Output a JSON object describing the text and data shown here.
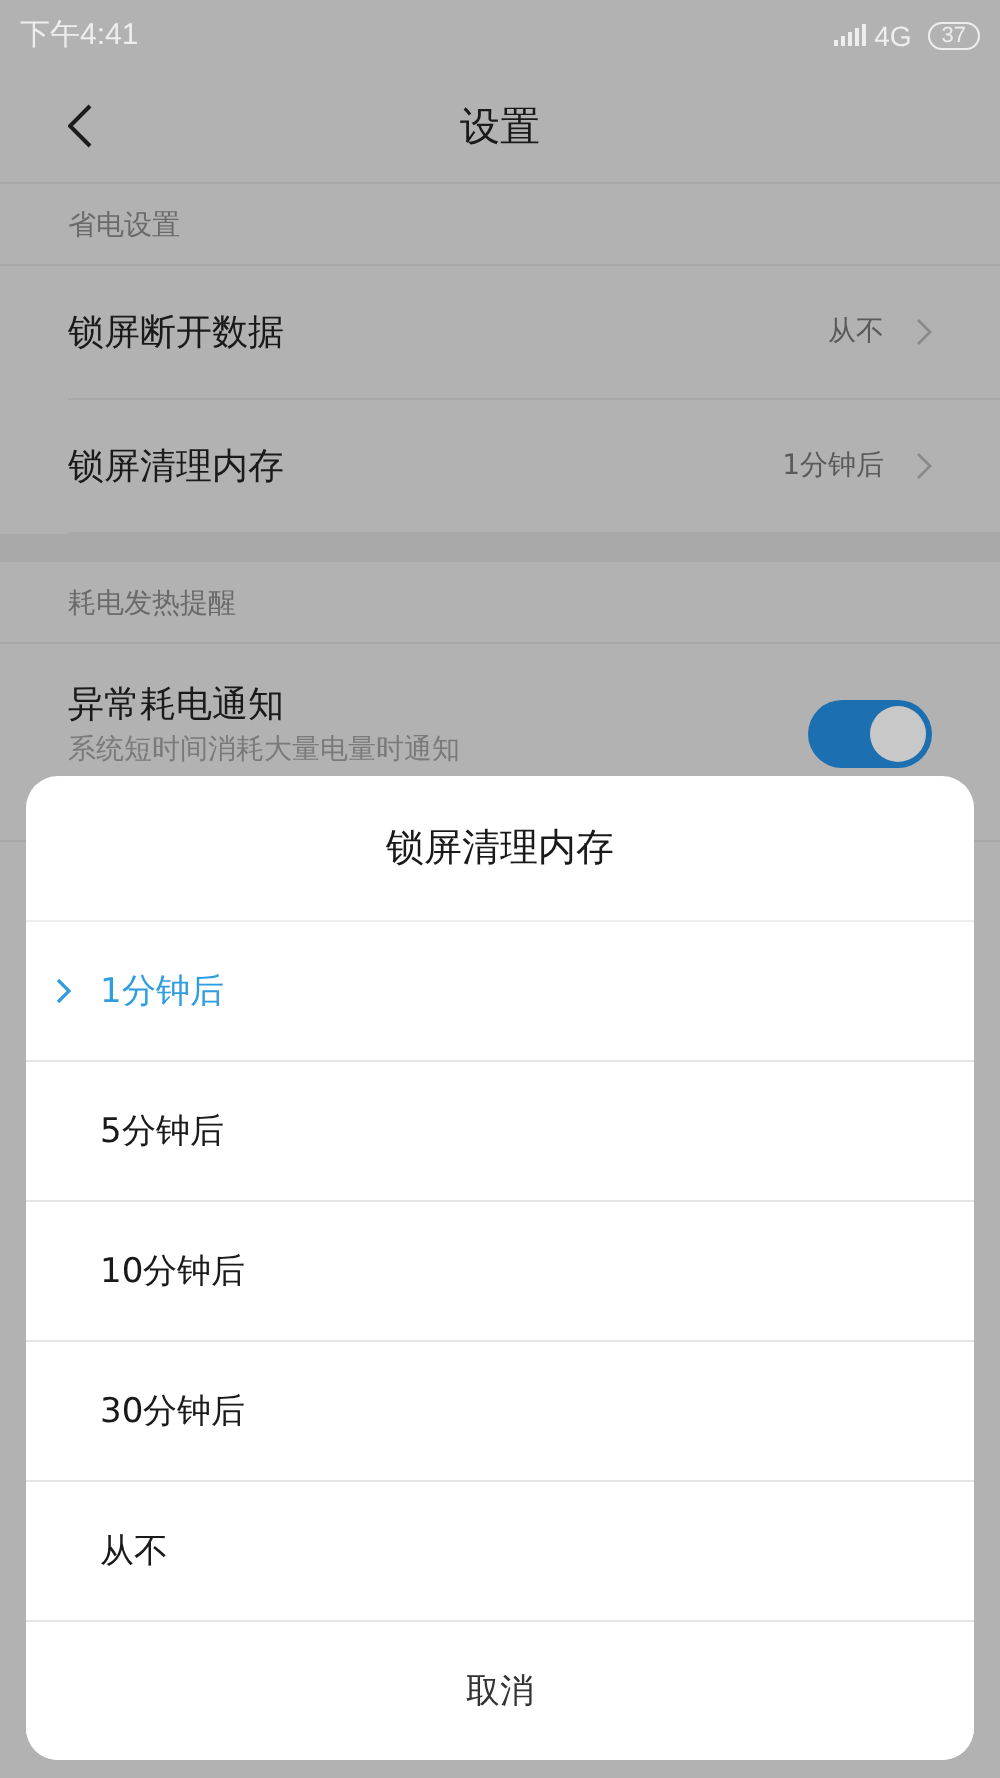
{
  "status_bar": {
    "time": "下午4:41",
    "network": "4G",
    "battery": "37"
  },
  "header": {
    "title": "设置"
  },
  "sections": [
    {
      "label": "省电设置",
      "rows": [
        {
          "kind": "value",
          "title": "锁屏断开数据",
          "value": "从不"
        },
        {
          "kind": "value",
          "title": "锁屏清理内存",
          "value": "1分钟后"
        }
      ]
    },
    {
      "label": "耗电发热提醒",
      "rows": [
        {
          "kind": "toggle",
          "title": "异常耗电通知",
          "subtitle": "系统短时间消耗大量电量时通知",
          "on": true
        }
      ]
    }
  ],
  "dialog": {
    "title": "锁屏清理内存",
    "options": [
      {
        "label": "1分钟后",
        "selected": true
      },
      {
        "label": "5分钟后",
        "selected": false
      },
      {
        "label": "10分钟后",
        "selected": false
      },
      {
        "label": "30分钟后",
        "selected": false
      },
      {
        "label": "从不",
        "selected": false
      }
    ],
    "cancel": "取消"
  }
}
